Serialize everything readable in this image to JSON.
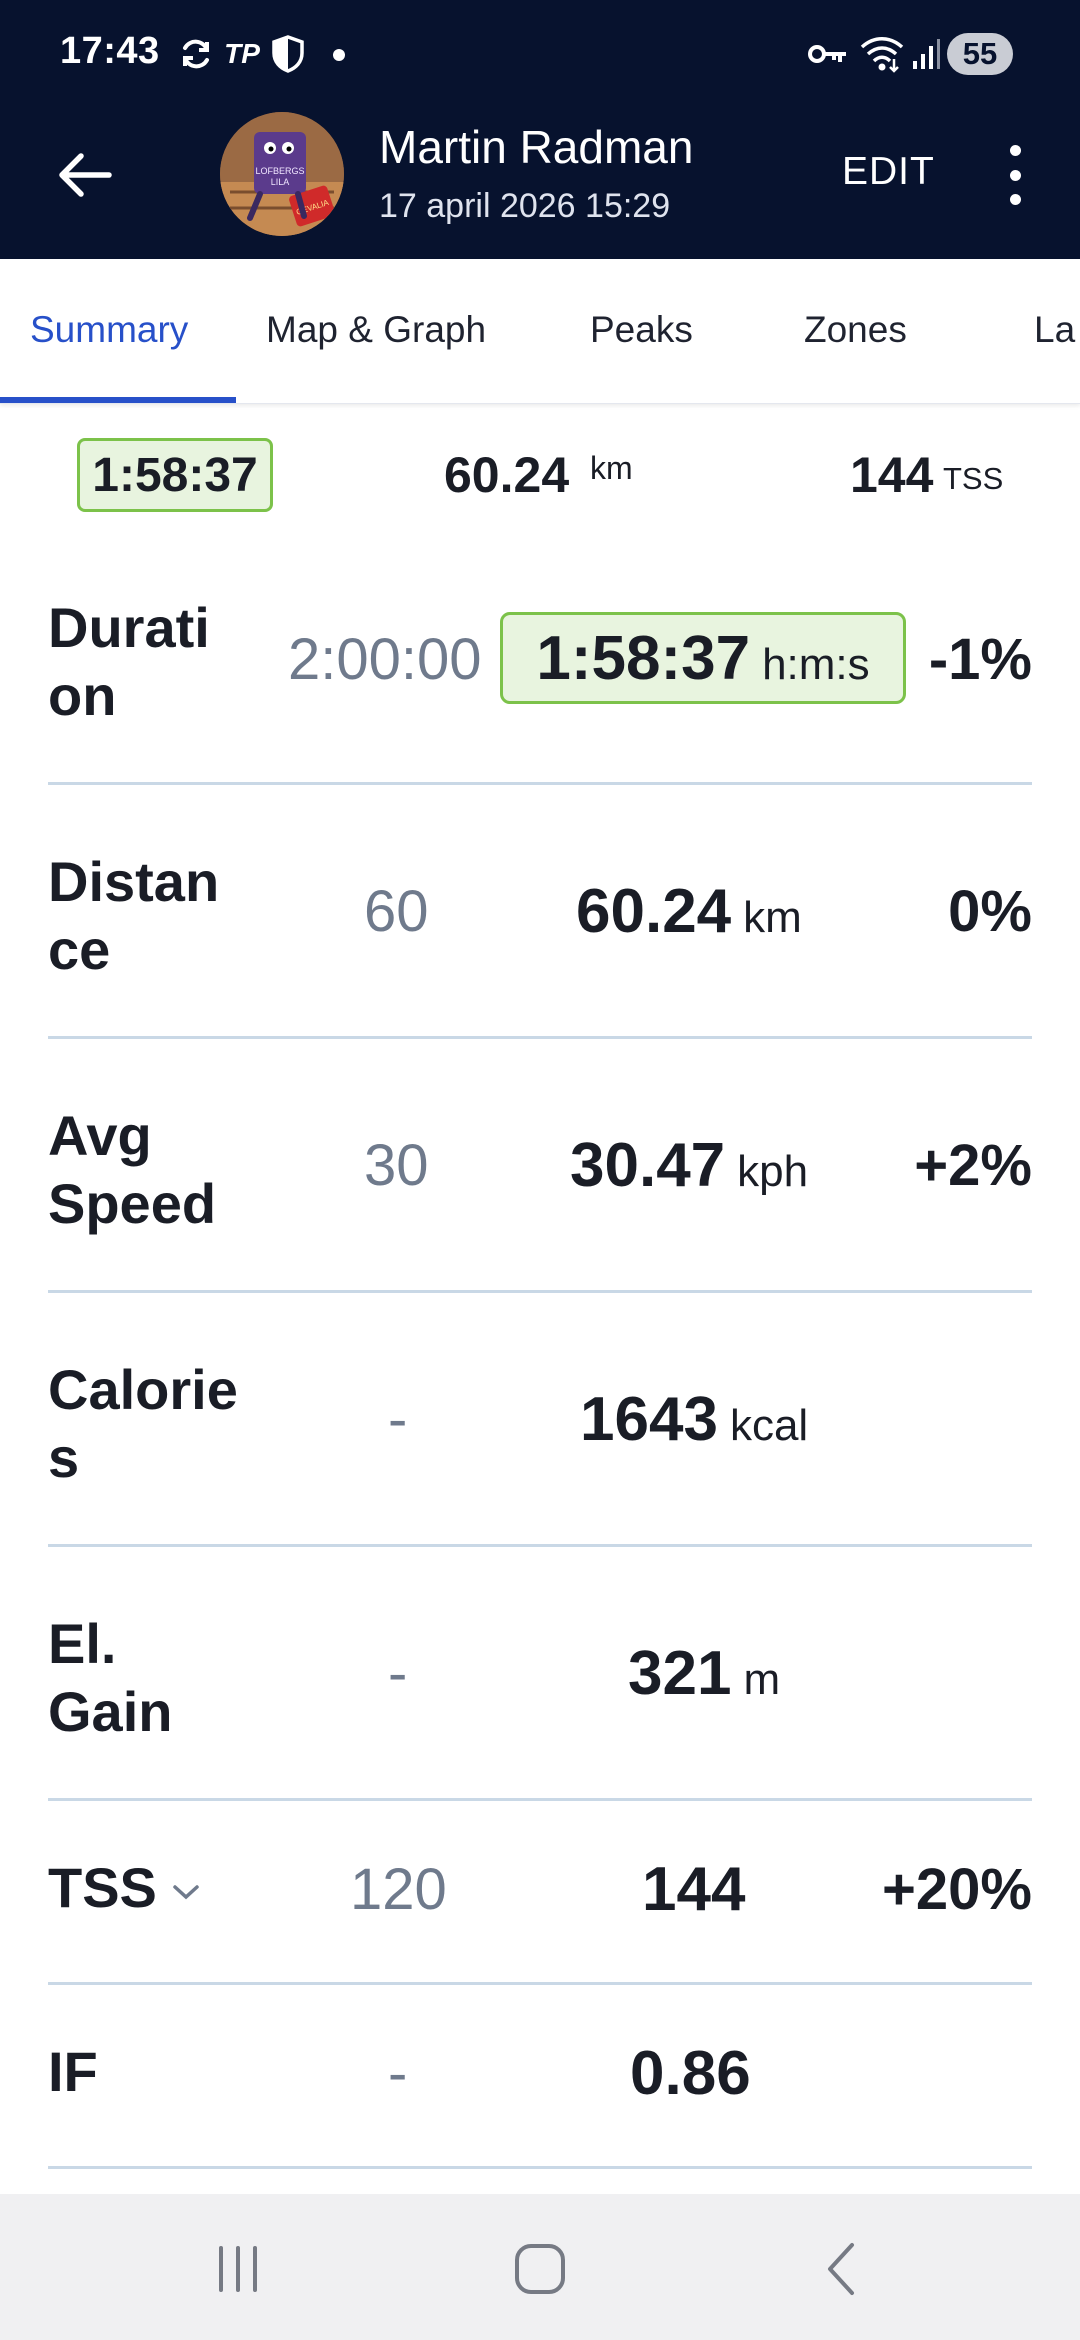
{
  "status_bar": {
    "time": "17:43",
    "carrier_badge": "TP",
    "battery": "55",
    "icons": [
      "sync-icon",
      "tp-icon",
      "shield-icon",
      "dot-icon",
      "vpn-key-icon",
      "wifi-icon",
      "signal-icon",
      "battery-icon"
    ]
  },
  "header": {
    "athlete_name": "Martin Radman",
    "workout_date": "17 april 2026 15:29",
    "edit_label": "EDIT",
    "icons": [
      "back-arrow-icon",
      "avatar",
      "more-vert-icon"
    ]
  },
  "tabs": [
    {
      "label": "Summary",
      "active": true
    },
    {
      "label": "Map & Graph",
      "active": false
    },
    {
      "label": "Peaks",
      "active": false
    },
    {
      "label": "Zones",
      "active": false
    },
    {
      "label": "La",
      "active": false
    }
  ],
  "summary": {
    "duration": "1:58:37",
    "distance": "60.24",
    "distance_unit": "km",
    "tss": "144",
    "tss_unit": "TSS"
  },
  "metrics": [
    {
      "label": "Duration",
      "planned": "2:00:00",
      "actual": "1:58:37",
      "unit": "h:m:s",
      "pct": "-1%",
      "highlight": true
    },
    {
      "label": "Distance",
      "planned": "60",
      "actual": "60.24",
      "unit": "km",
      "pct": "0%"
    },
    {
      "label": "Avg Speed",
      "planned": "30",
      "actual": "30.47",
      "unit": "kph",
      "pct": "+2%"
    },
    {
      "label": "Calories",
      "planned": "-",
      "actual": "1643",
      "unit": "kcal",
      "pct": ""
    },
    {
      "label": "El. Gain",
      "planned": "-",
      "actual": "321",
      "unit": "m",
      "pct": ""
    },
    {
      "label": "TSS",
      "planned": "120",
      "actual": "144",
      "unit": "",
      "pct": "+20%",
      "has_dropdown": true
    },
    {
      "label": "IF",
      "planned": "-",
      "actual": "0.86",
      "unit": "",
      "pct": ""
    }
  ],
  "colors": {
    "header_bg": "#07122e",
    "accent_blue": "#2750c9",
    "highlight_green": "#7cc24a",
    "highlight_bg": "#e8f4df",
    "divider": "#c9d8e6"
  }
}
